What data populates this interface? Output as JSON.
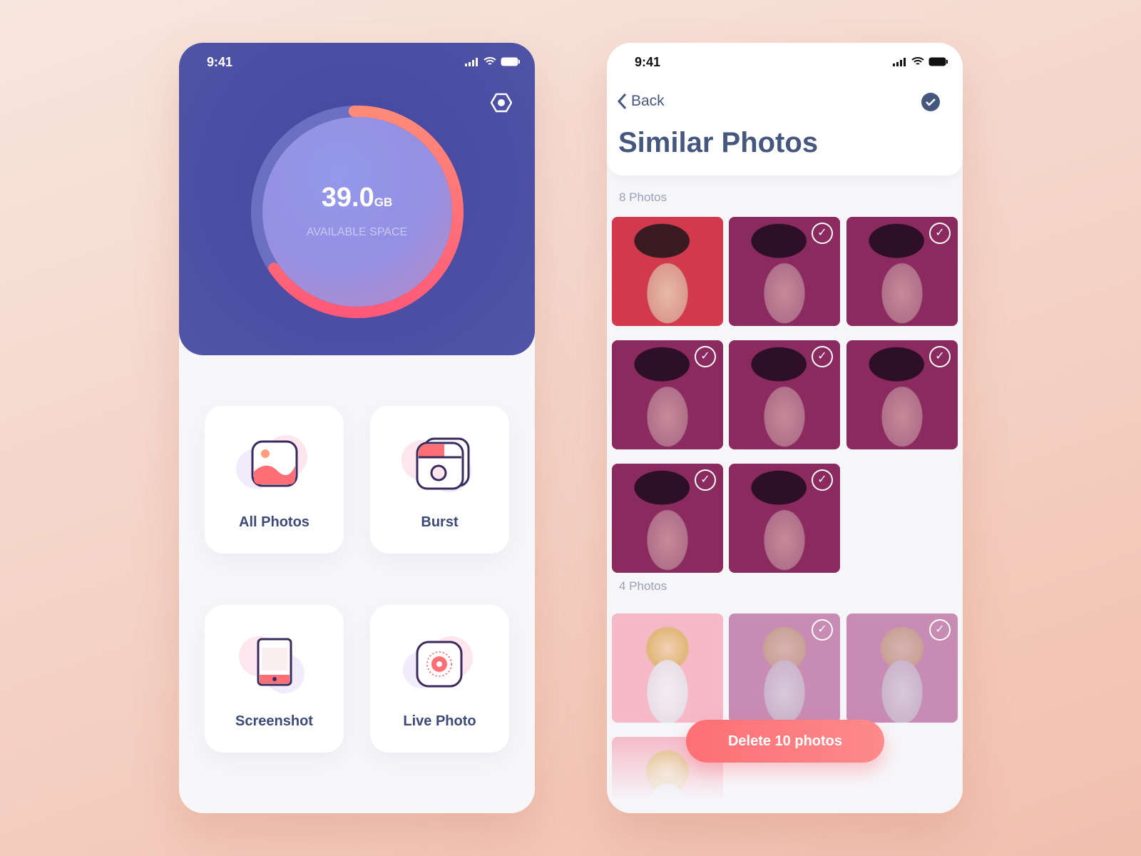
{
  "left": {
    "status": {
      "time": "9:41"
    },
    "storage": {
      "value": "39.0",
      "unit": "GB",
      "label": "AVAILABLE SPACE",
      "used_fraction": 0.66
    },
    "settings_icon": "hexagon-settings-icon",
    "categories": [
      {
        "label": "All Photos",
        "icon": "image-icon"
      },
      {
        "label": "Burst",
        "icon": "burst-icon"
      },
      {
        "label": "Screenshot",
        "icon": "phone-screenshot-icon"
      },
      {
        "label": "Live Photo",
        "icon": "live-photo-icon"
      }
    ]
  },
  "right": {
    "status": {
      "time": "9:41"
    },
    "back_label": "Back",
    "title": "Similar Photos",
    "groups": [
      {
        "label": "8 Photos",
        "photos": [
          {
            "selected": false
          },
          {
            "selected": true
          },
          {
            "selected": true
          },
          {
            "selected": true
          },
          {
            "selected": true
          },
          {
            "selected": true
          },
          {
            "selected": true
          },
          {
            "selected": true
          }
        ]
      },
      {
        "label": "4 Photos",
        "photos": [
          {
            "selected": false
          },
          {
            "selected": true
          },
          {
            "selected": true
          },
          {
            "selected": false
          }
        ]
      }
    ],
    "delete_label": "Delete 10 photos"
  },
  "colors": {
    "primary": "#4a4ba0",
    "accent": "#fd6f74",
    "text": "#3d4a78"
  }
}
